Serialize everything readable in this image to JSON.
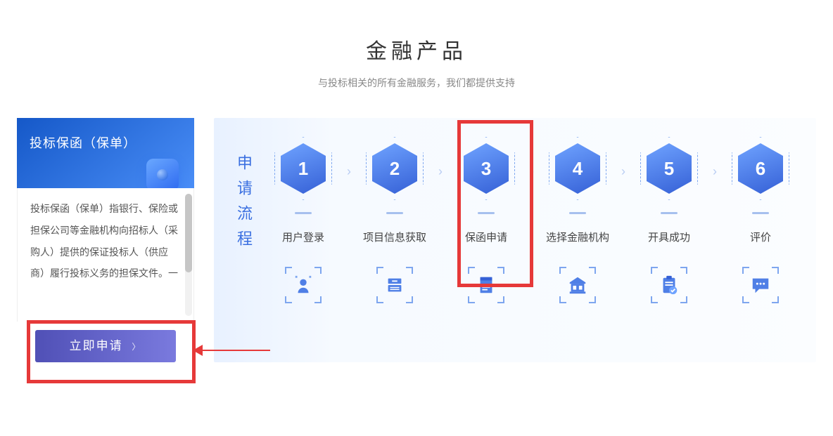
{
  "header": {
    "title": "金融产品",
    "subtitle": "与投标相关的所有金融服务，我们都提供支持"
  },
  "card": {
    "title": "投标保函（保单）",
    "body": "投标保函（保单）指银行、保险或担保公司等金融机构向招标人（采购人）提供的保证投标人（供应商）履行投标义务的担保文件。一",
    "apply_label": "立即申请"
  },
  "flow": {
    "vertical_label": "申请流程",
    "steps": [
      {
        "num": "1",
        "label": "用户登录",
        "icon": "user-icon"
      },
      {
        "num": "2",
        "label": "项目信息获取",
        "icon": "file-cabinet-icon"
      },
      {
        "num": "3",
        "label": "保函申请",
        "icon": "document-icon"
      },
      {
        "num": "4",
        "label": "选择金融机构",
        "icon": "bank-icon"
      },
      {
        "num": "5",
        "label": "开具成功",
        "icon": "clipboard-check-icon"
      },
      {
        "num": "6",
        "label": "评价",
        "icon": "chat-icon"
      }
    ]
  }
}
